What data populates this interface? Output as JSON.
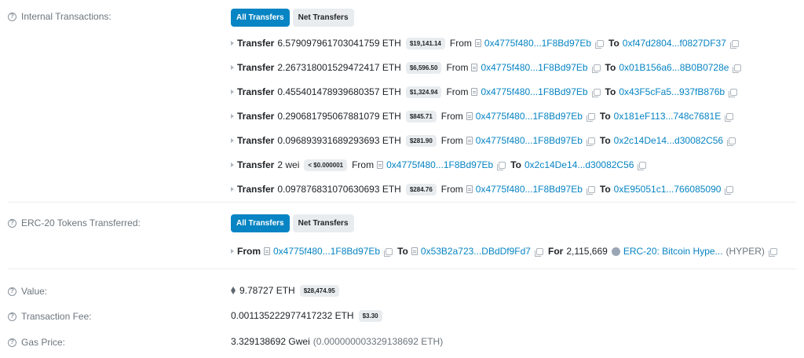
{
  "internal": {
    "label": "Internal Transactions:",
    "tabs": [
      "All Transfers",
      "Net Transfers"
    ],
    "transfers": [
      {
        "word": "Transfer",
        "amount": "6.579097961703041759 ETH",
        "usd": "$19,141.14",
        "from_kw": "From",
        "from": "0x4775f480...1F8Bd97Eb",
        "to_kw": "To",
        "to": "0xf47d2804...f0827DF37"
      },
      {
        "word": "Transfer",
        "amount": "2.267318001529472417 ETH",
        "usd": "$6,596.50",
        "from_kw": "From",
        "from": "0x4775f480...1F8Bd97Eb",
        "to_kw": "To",
        "to": "0x01B156a6...8B0B0728e"
      },
      {
        "word": "Transfer",
        "amount": "0.455401478939680357 ETH",
        "usd": "$1,324.94",
        "from_kw": "From",
        "from": "0x4775f480...1F8Bd97Eb",
        "to_kw": "To",
        "to": "0x43F5cFa5...937fB876b"
      },
      {
        "word": "Transfer",
        "amount": "0.290681795067881079 ETH",
        "usd": "$845.71",
        "from_kw": "From",
        "from": "0x4775f480...1F8Bd97Eb",
        "to_kw": "To",
        "to": "0x181eF113...748c7681E"
      },
      {
        "word": "Transfer",
        "amount": "0.096893931689293693 ETH",
        "usd": "$281.90",
        "from_kw": "From",
        "from": "0x4775f480...1F8Bd97Eb",
        "to_kw": "To",
        "to": "0x2c14De14...d30082C56"
      },
      {
        "word": "Transfer",
        "amount": "2 wei",
        "usd": "< $0.000001",
        "from_kw": "From",
        "from": "0x4775f480...1F8Bd97Eb",
        "to_kw": "To",
        "to": "0x2c14De14...d30082C56"
      },
      {
        "word": "Transfer",
        "amount": "0.097876831070630693 ETH",
        "usd": "$284.76",
        "from_kw": "From",
        "from": "0x4775f480...1F8Bd97Eb",
        "to_kw": "To",
        "to": "0xE95051c1...766085090"
      }
    ]
  },
  "erc20": {
    "label": "ERC-20 Tokens Transferred:",
    "tabs": [
      "All Transfers",
      "Net Transfers"
    ],
    "row": {
      "from_kw": "From",
      "from": "0x4775f480...1F8Bd97Eb",
      "to_kw": "To",
      "to": "0x53B2a723...DBdDf9Fd7",
      "for_kw": "For",
      "amount": "2,115,669",
      "token": "ERC-20: Bitcoin Hype...",
      "symbol": "(HYPER)"
    }
  },
  "value": {
    "label": "Value:",
    "amount": "9.78727 ETH",
    "usd": "$28,474.95"
  },
  "fee": {
    "label": "Transaction Fee:",
    "amount": "0.001135222977417232 ETH",
    "usd": "$3.30"
  },
  "gas": {
    "label": "Gas Price:",
    "gwei": "3.329138692 Gwei",
    "eth": "(0.000000003329138692 ETH)"
  }
}
